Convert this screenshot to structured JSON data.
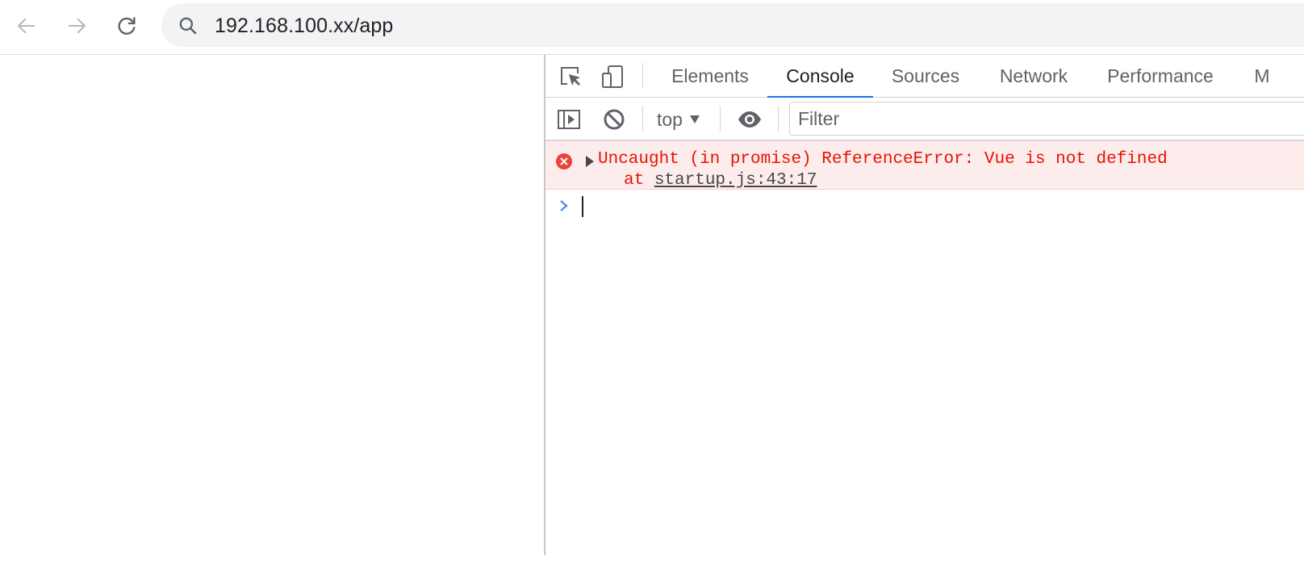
{
  "browser": {
    "url": "192.168.100.xx/app"
  },
  "devtools": {
    "tabs": [
      {
        "label": "Elements",
        "active": false
      },
      {
        "label": "Console",
        "active": true
      },
      {
        "label": "Sources",
        "active": false
      },
      {
        "label": "Network",
        "active": false
      },
      {
        "label": "Performance",
        "active": false
      },
      {
        "label": "M",
        "active": false
      }
    ],
    "console": {
      "context": "top",
      "filter_placeholder": "Filter",
      "error": {
        "message": "Uncaught (in promise) ReferenceError: Vue is not defined",
        "at_prefix": "at ",
        "location": "startup.js:43:17"
      }
    }
  },
  "colors": {
    "accent": "#1a73e8",
    "error_text": "#e51400",
    "error_bg": "#fdecec"
  }
}
